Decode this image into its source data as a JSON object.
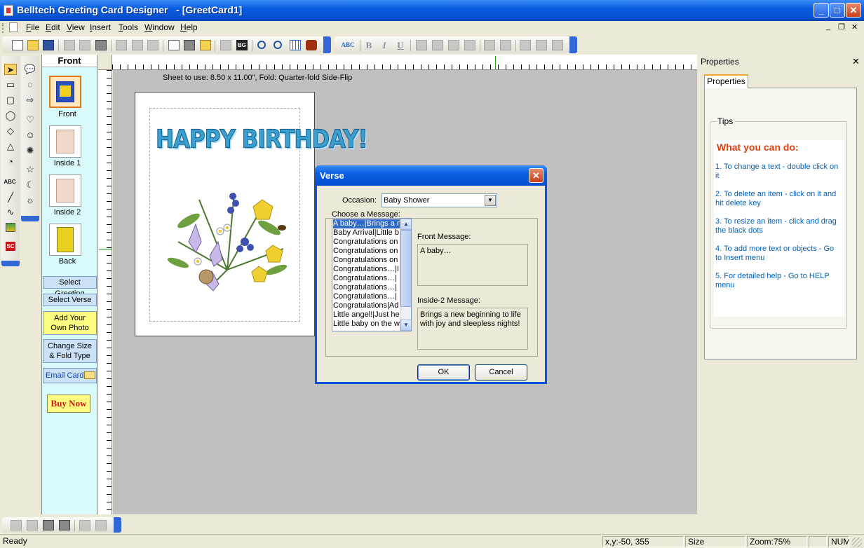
{
  "window": {
    "title": "Belltech Greeting Card Designer   - [GreetCard1]",
    "minimize": "_",
    "maximize": "□",
    "close": "✕"
  },
  "menu": {
    "items": [
      {
        "label": "File",
        "ul": "F",
        "rest": "ile"
      },
      {
        "label": "Edit",
        "ul": "E",
        "rest": "dit"
      },
      {
        "label": "View",
        "ul": "V",
        "rest": "iew"
      },
      {
        "label": "Insert",
        "ul": "I",
        "rest": "nsert"
      },
      {
        "label": "Tools",
        "ul": "T",
        "rest": "ools"
      },
      {
        "label": "Window",
        "ul": "W",
        "rest": "indow"
      },
      {
        "label": "Help",
        "ul": "H",
        "rest": "elp"
      }
    ],
    "mdi_min": "_",
    "mdi_restore": "❐",
    "mdi_close": "✕"
  },
  "toolbar": {
    "bg_label": "BG",
    "spell_label": "ABC",
    "bold": "B",
    "italic": "I",
    "underline": "U"
  },
  "draw_tools": {
    "text_tool": "ABC",
    "sc_label": "SC"
  },
  "pages": {
    "header": "Front",
    "front": "Front",
    "inside1": "Inside 1",
    "inside2": "Inside 2",
    "back": "Back"
  },
  "side_buttons": {
    "select_greeting": "Select Greeting",
    "select_verse": "Select Verse",
    "add_photo_1": "Add Your",
    "add_photo_2": "Own Photo",
    "change_size_1": "Change Size",
    "change_size_2": "& Fold Type",
    "email_card": "Email Card",
    "buy_now": "Buy Now"
  },
  "canvas": {
    "sheet_info": "Sheet to use: 8.50 x 11.00\", Fold: Quarter-fold Side-Flip",
    "card_title": "HAPPY BIRTHDAY!"
  },
  "properties": {
    "panel_title": "Properties",
    "close": "✕",
    "tab": "Properties",
    "tips_legend": "Tips",
    "tips_heading": "What you can do:",
    "tips": [
      "1. To change a text - double click on it",
      "2. To delete an item - click on it and hit delete key",
      "3. To resize an item - click and drag the black dots",
      "4. To add more text or objects - Go to Insert menu",
      "5. For detailed help - Go to HELP menu"
    ]
  },
  "dialog": {
    "title": "Verse",
    "close": "✕",
    "occasion_label": "Occasion:",
    "occasion_value": "Baby Shower",
    "choose_label": "Choose a Message:",
    "messages": [
      "A baby…|Brings a n",
      "Baby Arrival|Little b",
      "Congratulations on",
      "Congratulations on",
      "Congratulations on",
      "Congratulations…|I",
      "Congratulations…|",
      "Congratulations…|",
      "Congratulations…|",
      "Congratulations|Ad",
      "Little angel!|Just he",
      "Little baby on the w"
    ],
    "front_label": "Front Message:",
    "front_value": "A baby…",
    "inside2_label": "Inside-2 Message:",
    "inside2_value": "Brings a new beginning to life with joy and sleepless nights!",
    "ok": "OK",
    "cancel": "Cancel"
  },
  "status": {
    "ready": "Ready",
    "coords": "x,y:-50, 355",
    "size": "Size",
    "zoom": "Zoom:75%",
    "num": "NUM"
  }
}
